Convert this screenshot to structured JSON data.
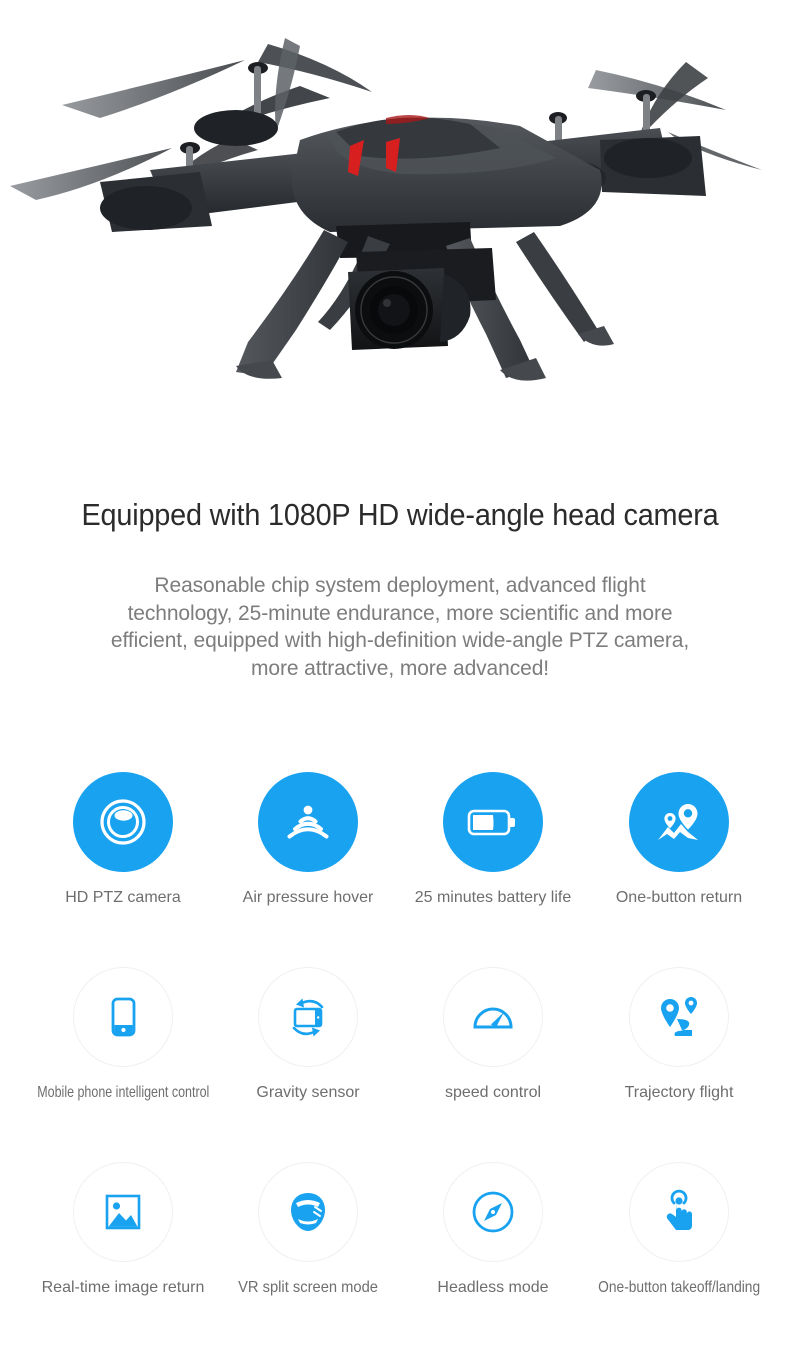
{
  "product_image": {
    "alt": "black quadcopter drone with four propellers, red led accents and gimbal camera",
    "body_color": "#3c3f43",
    "accent_color": "#d81f20",
    "camera_label": "gimbal-camera"
  },
  "headline": "Equipped with 1080P HD wide-angle head camera",
  "subcopy": "Reasonable chip system deployment, advanced flight technology, 25-minute endurance, more scientific and more efficient, equipped with high-definition wide-angle PTZ camera, more attractive, more advanced!",
  "colors": {
    "accent_blue": "#18a2f0",
    "badge_outline": "#f0f0f0",
    "heading_text": "#2b2b2b",
    "body_text": "#7d7d7d",
    "caption_text": "#6e6e6e"
  },
  "features": {
    "rows": [
      {
        "style": "filled",
        "items": [
          {
            "label": "HD PTZ camera",
            "icon": "camera-lens-icon"
          },
          {
            "label": "Air pressure hover",
            "icon": "signal-waves-icon"
          },
          {
            "label": "25 minutes battery life",
            "icon": "battery-icon"
          },
          {
            "label": "One-button return",
            "icon": "map-pins-return-icon"
          }
        ]
      },
      {
        "style": "outline",
        "items": [
          {
            "label": "Mobile phone intelligent control",
            "icon": "smartphone-icon"
          },
          {
            "label": "Gravity sensor",
            "icon": "gravity-rotate-icon"
          },
          {
            "label": "speed control",
            "icon": "speedometer-icon"
          },
          {
            "label": "Trajectory flight",
            "icon": "trajectory-path-icon"
          }
        ]
      },
      {
        "style": "outline",
        "items": [
          {
            "label": "Real-time image return",
            "icon": "picture-icon"
          },
          {
            "label": "VR split screen mode",
            "icon": "vr-headset-icon"
          },
          {
            "label": "Headless mode",
            "icon": "compass-icon"
          },
          {
            "label": "One-button takeoff/landing",
            "icon": "tap-hand-icon"
          }
        ]
      }
    ]
  }
}
